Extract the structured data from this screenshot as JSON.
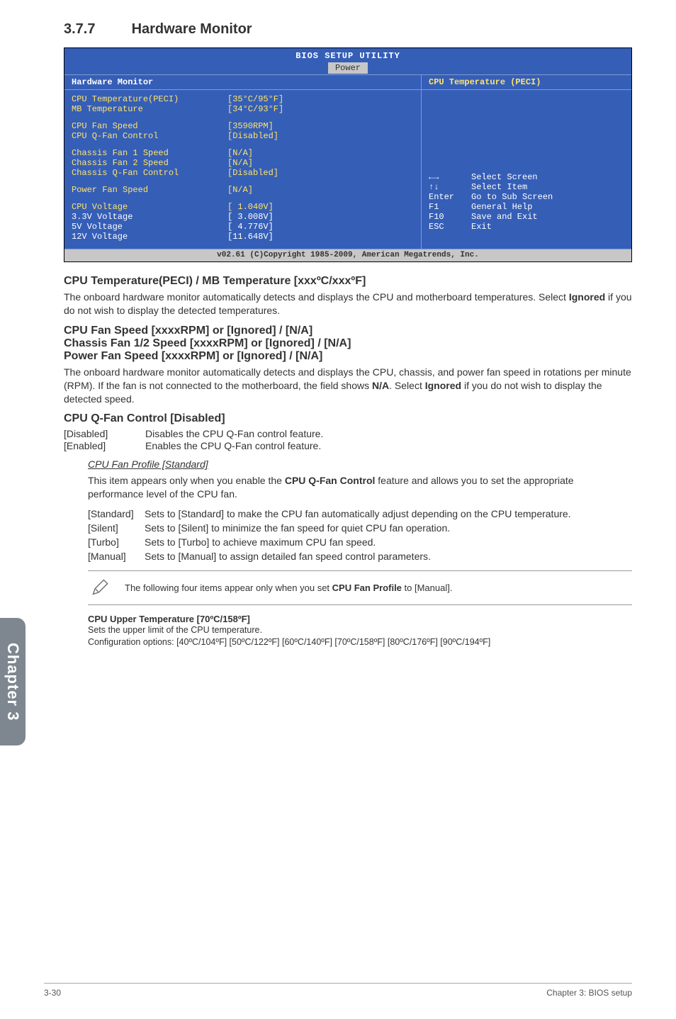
{
  "sidebar": {
    "label": "Chapter 3"
  },
  "section": {
    "number": "3.7.7",
    "title": "Hardware Monitor"
  },
  "bios": {
    "title": "BIOS SETUP UTILITY",
    "tab": "Power",
    "left_header": "Hardware Monitor",
    "right_header": "CPU Temperature (PECI)",
    "rows": [
      {
        "label": "CPU Temperature(PECI)",
        "value": "[35°C/95°F]",
        "white": false
      },
      {
        "label": "MB Temperature",
        "value": "[34°C/93°F]",
        "white": false
      },
      {
        "spacer": true
      },
      {
        "label": "CPU Fan Speed",
        "value": "[3590RPM]",
        "white": false
      },
      {
        "label": "CPU Q-Fan Control",
        "value": "[Disabled]",
        "white": false
      },
      {
        "spacer": true
      },
      {
        "label": "Chassis Fan 1 Speed",
        "value": "[N/A]",
        "white": false
      },
      {
        "label": "Chassis Fan 2 Speed",
        "value": "[N/A]",
        "white": false
      },
      {
        "label": "Chassis Q-Fan Control",
        "value": "[Disabled]",
        "white": false
      },
      {
        "spacer": true
      },
      {
        "label": "Power Fan Speed",
        "value": "[N/A]",
        "white": false
      },
      {
        "spacer": true
      },
      {
        "label": "CPU   Voltage",
        "value": "[ 1.040V]",
        "white": false
      },
      {
        "label": "3.3V  Voltage",
        "value": "[ 3.008V]",
        "white": true
      },
      {
        "label": "5V    Voltage",
        "value": "[ 4.776V]",
        "white": true
      },
      {
        "label": "12V   Voltage",
        "value": "[11.648V]",
        "white": true
      }
    ],
    "help": [
      {
        "key": "←→",
        "desc": "Select Screen"
      },
      {
        "key": "↑↓",
        "desc": "Select Item"
      },
      {
        "key": "Enter",
        "desc": "Go to Sub Screen"
      },
      {
        "key": "F1",
        "desc": "General Help"
      },
      {
        "key": "F10",
        "desc": "Save and Exit"
      },
      {
        "key": "ESC",
        "desc": "Exit"
      }
    ],
    "footer": "v02.61 (C)Copyright 1985-2009, American Megatrends, Inc."
  },
  "body": {
    "h_temp": "CPU Temperature(PECI) / MB Temperature [xxxºC/xxxºF]",
    "p_temp_1": "The onboard hardware monitor automatically detects and displays the CPU and motherboard temperatures. Select ",
    "p_temp_bold": "Ignored",
    "p_temp_2": " if you do not wish to display the detected temperatures.",
    "h_fan_1": "CPU Fan Speed [xxxxRPM] or [Ignored] / [N/A]",
    "h_fan_2": "Chassis Fan 1/2 Speed [xxxxRPM] or [Ignored] / [N/A]",
    "h_fan_3": "Power Fan Speed [xxxxRPM] or [Ignored] / [N/A]",
    "p_fan_1": "The onboard hardware monitor automatically detects and displays the CPU, chassis, and power fan speed in rotations per minute (RPM). If the fan is not connected to the motherboard, the field shows ",
    "p_fan_bold_na": "N/A",
    "p_fan_mid": ". Select ",
    "p_fan_bold_ig": "Ignored",
    "p_fan_2": " if you do not wish to display the detected speed.",
    "h_qfan": "CPU Q-Fan Control [Disabled]",
    "qfan_opts": [
      {
        "k": "[Disabled]",
        "v": "Disables the CPU Q-Fan control feature."
      },
      {
        "k": "[Enabled]",
        "v": "Enables the CPU Q-Fan control feature."
      }
    ],
    "profile_h": "CPU Fan Profile [Standard]",
    "profile_p_1": "This item appears only when you enable the ",
    "profile_bold": "CPU Q-Fan Control",
    "profile_p_2": " feature and allows you to set the appropriate performance level of the CPU fan.",
    "profile_opts": [
      {
        "k": "[Standard]",
        "v": "Sets to [Standard] to make the CPU fan automatically adjust depending on the CPU temperature."
      },
      {
        "k": "[Silent]",
        "v": "Sets to [Silent] to minimize the fan speed for quiet CPU fan operation."
      },
      {
        "k": "[Turbo]",
        "v": "Sets to [Turbo] to achieve maximum CPU fan speed."
      },
      {
        "k": "[Manual]",
        "v": "Sets to [Manual] to assign detailed fan speed control parameters."
      }
    ],
    "note_1": "The following four items appear only when you set ",
    "note_bold": "CPU Fan Profile",
    "note_2": " to [Manual].",
    "upper_h": "CPU Upper Temperature [70ºC/158ºF]",
    "upper_p1": "Sets the upper limit of the CPU temperature.",
    "upper_p2": "Configuration options: [40ºC/104ºF] [50ºC/122ºF] [60ºC/140ºF] [70ºC/158ºF] [80ºC/176ºF] [90ºC/194ºF]"
  },
  "footer": {
    "left": "3-30",
    "right": "Chapter 3: BIOS setup"
  }
}
